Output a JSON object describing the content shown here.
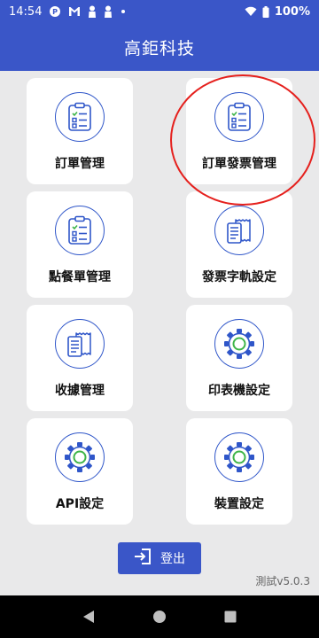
{
  "status_bar": {
    "time": "14:54",
    "battery": "100%",
    "icons": [
      "app-notification-icon",
      "gmail-icon",
      "person-icon",
      "person-icon",
      "dot-icon",
      "wifi-icon",
      "battery-icon"
    ]
  },
  "app_bar": {
    "title": "高鉅科技"
  },
  "menu": {
    "items": [
      {
        "label": "訂單管理",
        "icon": "clipboard-list-icon"
      },
      {
        "label": "訂單發票管理",
        "icon": "clipboard-list-icon"
      },
      {
        "label": "點餐單管理",
        "icon": "clipboard-list-icon"
      },
      {
        "label": "發票字軌設定",
        "icon": "receipt-icon"
      },
      {
        "label": "收據管理",
        "icon": "receipt-icon"
      },
      {
        "label": "印表機設定",
        "icon": "gear-icon"
      },
      {
        "label": "API設定",
        "icon": "gear-icon"
      },
      {
        "label": "裝置設定",
        "icon": "gear-icon"
      }
    ]
  },
  "logout": {
    "label": "登出",
    "icon": "logout-icon"
  },
  "footer": {
    "version": "測試v5.0.3"
  },
  "colors": {
    "primary": "#3a56c8",
    "icon_blue": "#2f56c9",
    "icon_green": "#3fb549",
    "highlight_red": "#e5201d"
  }
}
